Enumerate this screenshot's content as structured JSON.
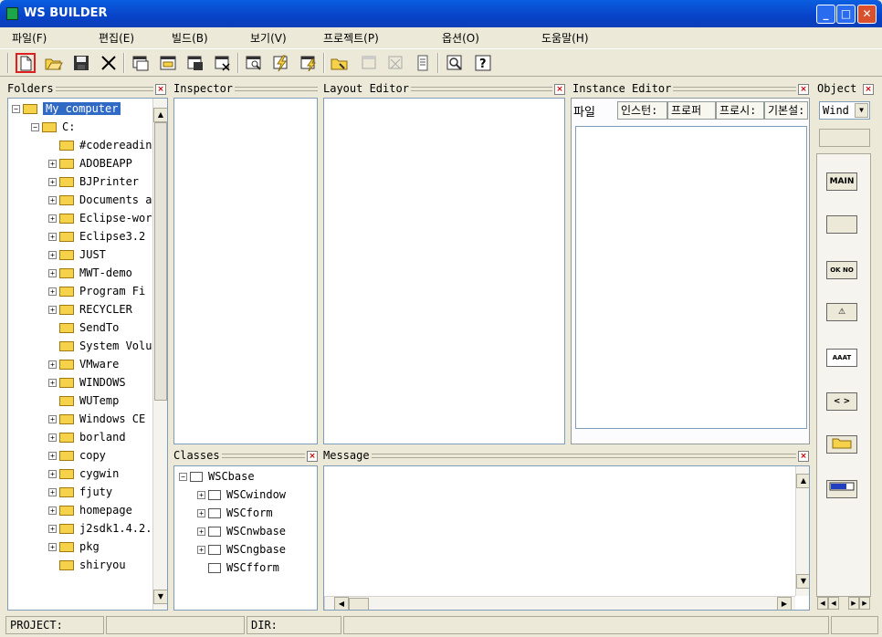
{
  "window": {
    "title": "WS BUILDER",
    "minimize": "_",
    "maximize": "□",
    "close": "✕"
  },
  "menu": [
    "파일(F)",
    "편집(E)",
    "빌드(B)",
    "보기(V)",
    "프로젝트(P)",
    "옵션(O)",
    "도움말(H)"
  ],
  "toolbar": {
    "buttons": [
      "new-file",
      "open-folder",
      "save",
      "delete",
      "window",
      "form",
      "window-save",
      "window-close",
      "inspect",
      "build",
      "build-all",
      "open-project",
      "disabled-1",
      "disabled-2",
      "list",
      "preview",
      "help"
    ],
    "selected": "new-file"
  },
  "folders": {
    "title": "Folders",
    "close": "×",
    "root": "My computer",
    "drive": "C:",
    "items": [
      {
        "label": "#codereadin",
        "expandable": false
      },
      {
        "label": "ADOBEAPP",
        "expandable": true
      },
      {
        "label": "BJPrinter",
        "expandable": true
      },
      {
        "label": "Documents a",
        "expandable": true
      },
      {
        "label": "Eclipse-wor",
        "expandable": true
      },
      {
        "label": "Eclipse3.2",
        "expandable": true
      },
      {
        "label": "JUST",
        "expandable": true
      },
      {
        "label": "MWT-demo",
        "expandable": true
      },
      {
        "label": "Program Fi",
        "expandable": true
      },
      {
        "label": "RECYCLER",
        "expandable": true
      },
      {
        "label": "SendTo",
        "expandable": false
      },
      {
        "label": "System Volu",
        "expandable": false
      },
      {
        "label": "VMware",
        "expandable": true
      },
      {
        "label": "WINDOWS",
        "expandable": true
      },
      {
        "label": "WUTemp",
        "expandable": false
      },
      {
        "label": "Windows CE",
        "expandable": true
      },
      {
        "label": "borland",
        "expandable": true
      },
      {
        "label": "copy",
        "expandable": true
      },
      {
        "label": "cygwin",
        "expandable": true
      },
      {
        "label": "fjuty",
        "expandable": true
      },
      {
        "label": "homepage",
        "expandable": true
      },
      {
        "label": "j2sdk1.4.2.",
        "expandable": true
      },
      {
        "label": "pkg",
        "expandable": true
      },
      {
        "label": "shiryou",
        "expandable": false
      }
    ]
  },
  "inspector": {
    "title": "Inspector"
  },
  "layout_editor": {
    "title": "Layout Editor",
    "close": "×"
  },
  "instance_editor": {
    "title": "Instance Editor",
    "close": "×",
    "tabs": [
      "파일",
      "인스턴:",
      "프로퍼",
      "프로시:",
      "기본설:"
    ]
  },
  "object": {
    "title": "Object",
    "close": "×",
    "combo_value": "Wind",
    "buttons": [
      "MAIN",
      "",
      "OK NO",
      "⚠",
      "AAAT",
      "< >",
      "folder",
      "bar"
    ]
  },
  "classes": {
    "title": "Classes",
    "close": "×",
    "root": "WSCbase",
    "items": [
      {
        "label": "WSCwindow",
        "expandable": true
      },
      {
        "label": "WSCform",
        "expandable": true
      },
      {
        "label": "WSCnwbase",
        "expandable": true
      },
      {
        "label": "WSCngbase",
        "expandable": true
      },
      {
        "label": "WSCfform",
        "expandable": false
      }
    ]
  },
  "message": {
    "title": "Message",
    "close": "×"
  },
  "status": {
    "project": "PROJECT:",
    "dir": "DIR:"
  }
}
